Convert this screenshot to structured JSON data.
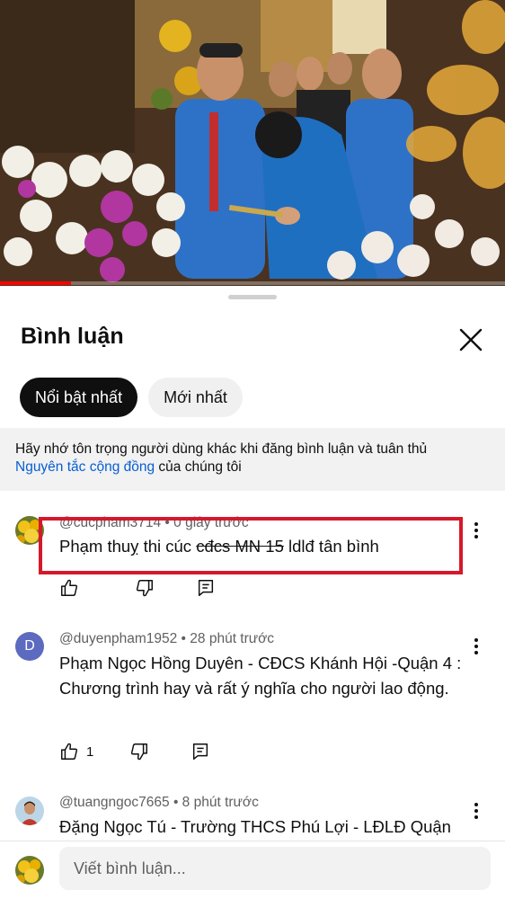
{
  "video": {
    "progress_fraction": 0.14
  },
  "comments_panel": {
    "title": "Bình luận",
    "close_icon": "close-icon",
    "sort_chips": [
      {
        "label": "Nổi bật nhất",
        "selected": true
      },
      {
        "label": "Mới nhất",
        "selected": false
      }
    ],
    "notice": {
      "text": "Hãy nhớ tôn trọng người dùng khác khi đăng bình luận và tuân thủ",
      "link": "Nguyên tắc cộng đồng",
      "suffix": " của chúng tôi"
    },
    "comments": [
      {
        "handle": "@cucpham3714",
        "time": "0 giây trước",
        "text_before": "Phạm thuỵ thi cúc ",
        "text_struck": "cđcs MN 15",
        "text_after": " ldlđ tân bình",
        "like_count": "",
        "avatar": "flower-avatar",
        "highlighted": true
      },
      {
        "handle": "@duyenpham1952",
        "time": "28 phút trước",
        "text": "Phạm Ngọc Hồng Duyên - CĐCS Khánh Hội -Quận 4 : Chương trình hay và rất ý nghĩa cho người lao động.",
        "like_count": "1",
        "avatar_letter": "D",
        "avatar_color": "#5c6bc0"
      },
      {
        "handle": "@tuangngoc7665",
        "time": "8 phút trước",
        "text": "Đặng Ngọc Tú - Trường THCS Phú Lợi - LĐLĐ Quận",
        "avatar": "photo-avatar"
      }
    ],
    "composer": {
      "placeholder": "Viết bình luận..."
    }
  },
  "colors": {
    "accent_red": "#d6182b",
    "link_blue": "#065fd4",
    "chip_active_bg": "#0f0f0f",
    "chip_inactive_bg": "#f0f0f0"
  }
}
